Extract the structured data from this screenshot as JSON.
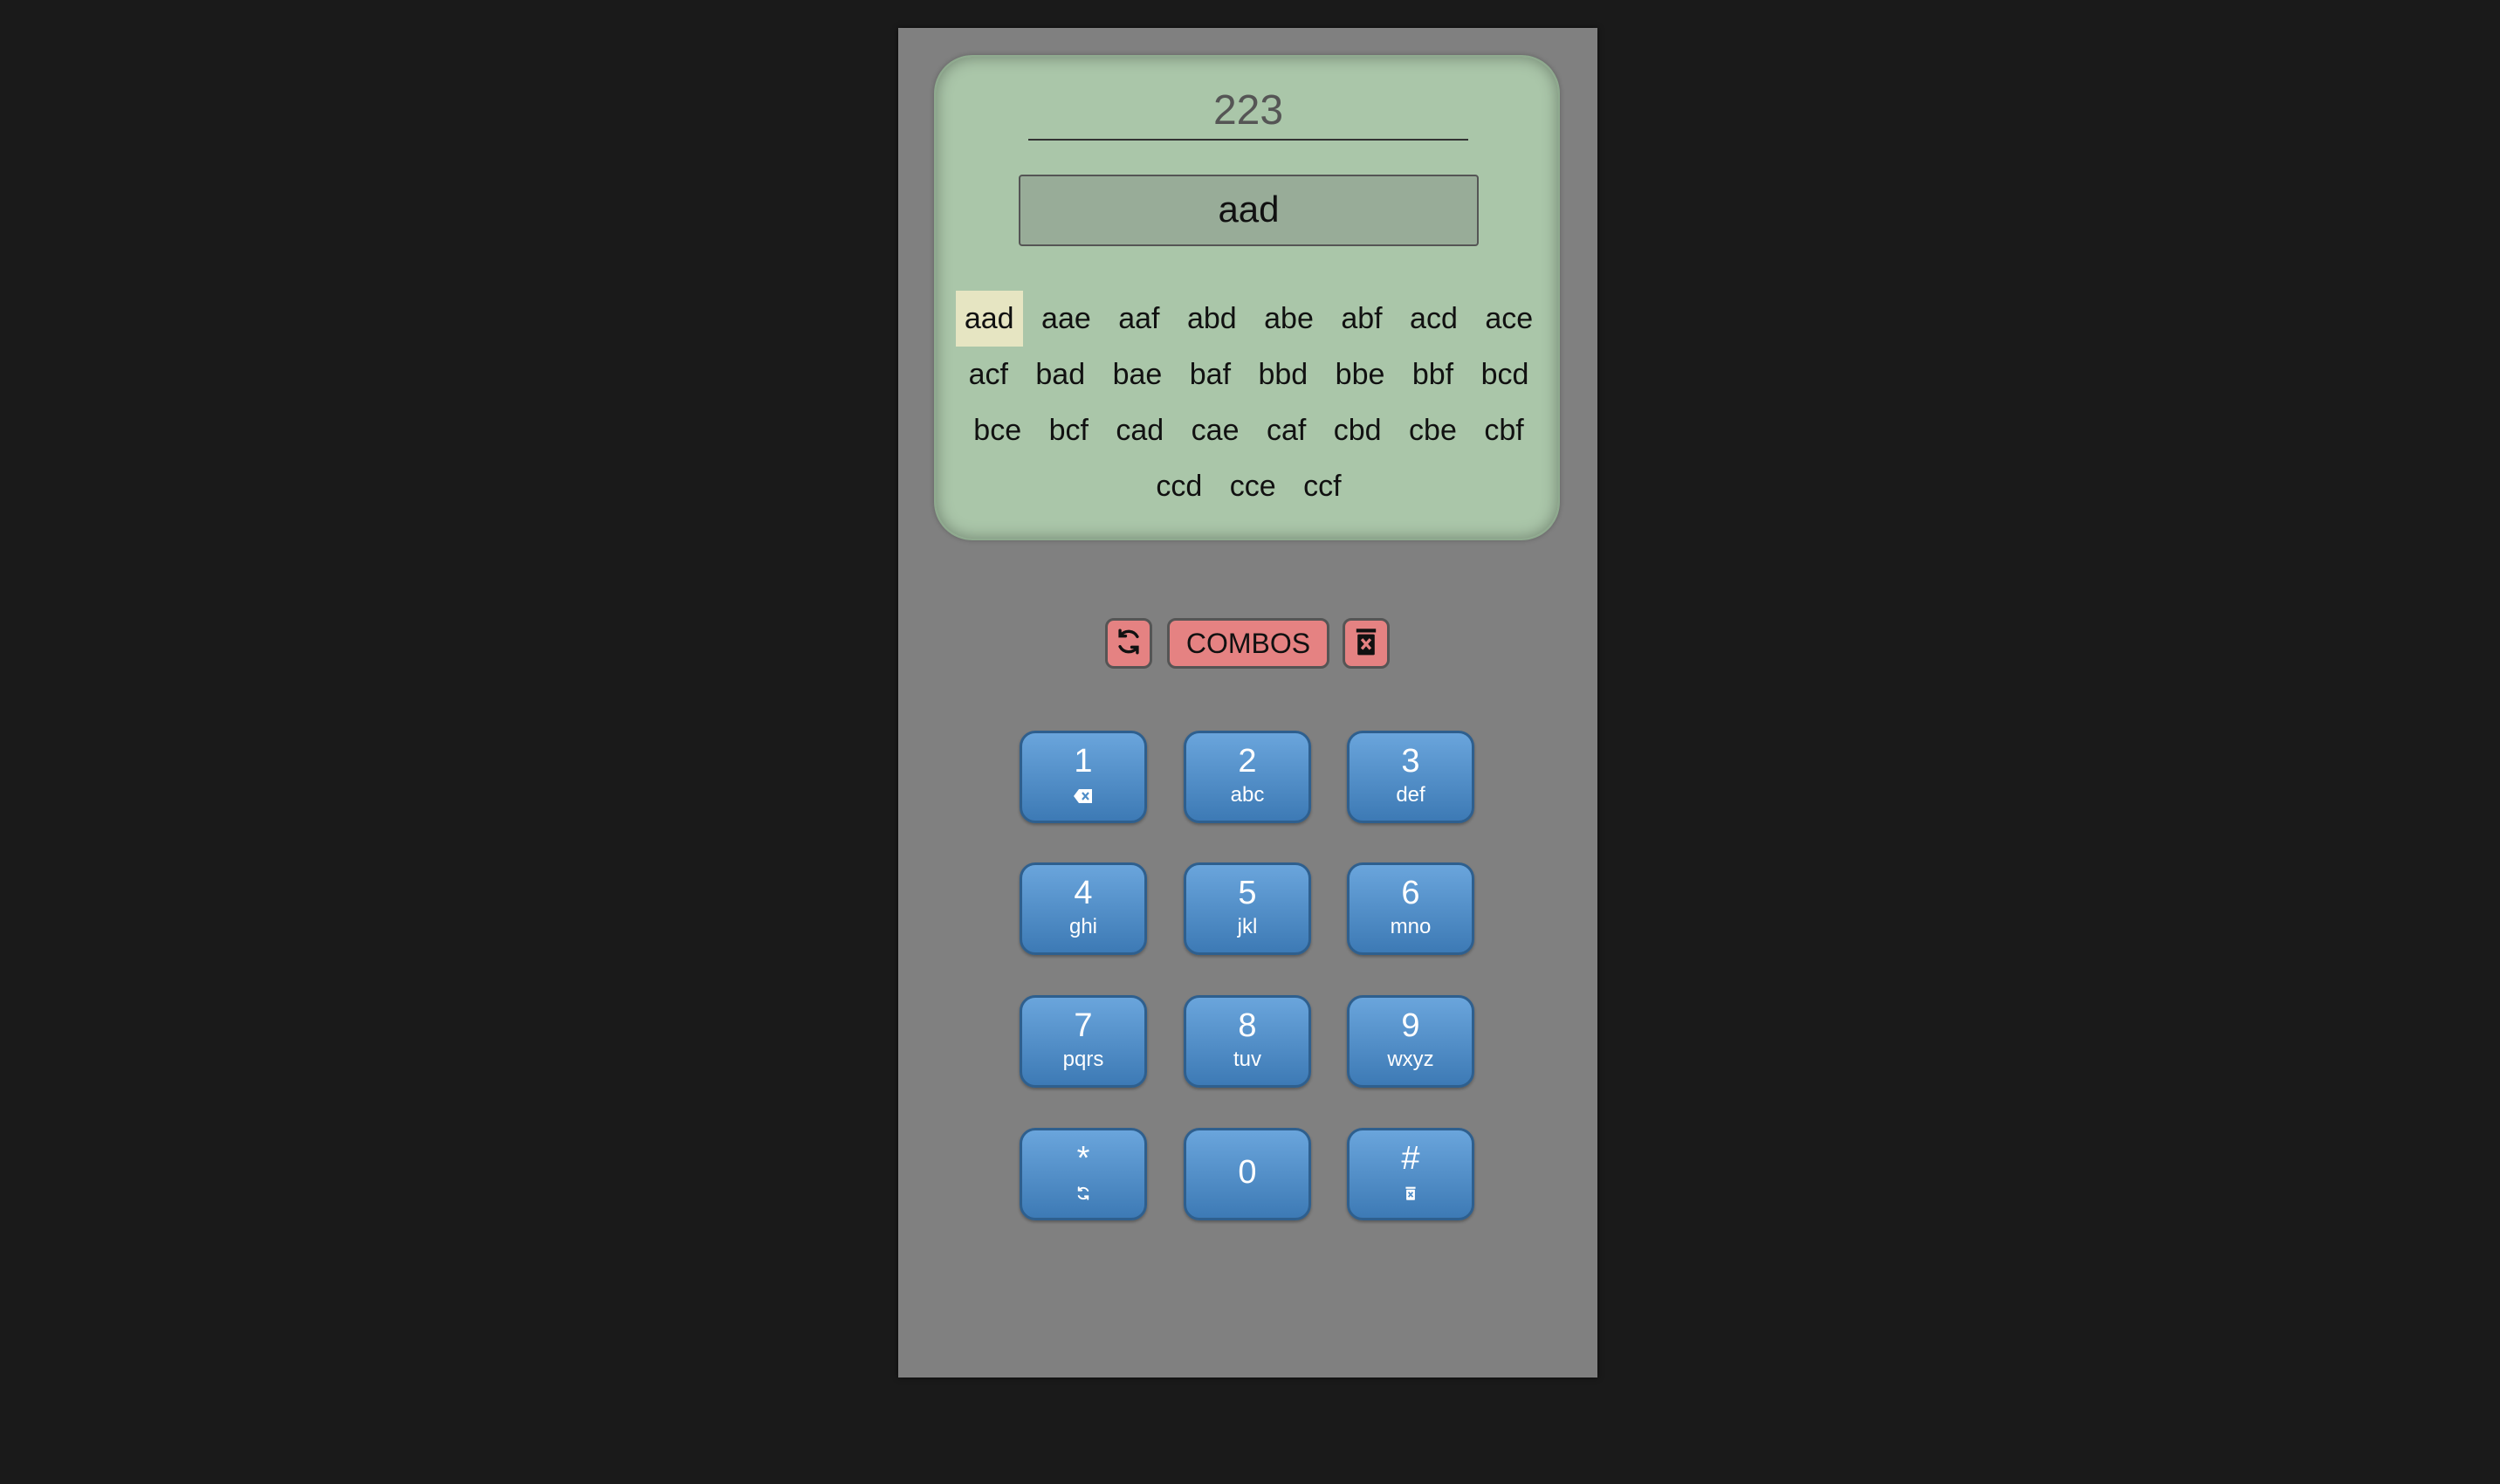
{
  "screen": {
    "digits": "223",
    "current_word": "aad",
    "suggestions": [
      "aad",
      "aae",
      "aaf",
      "abd",
      "abe",
      "abf",
      "acd",
      "ace",
      "acf",
      "bad",
      "bae",
      "baf",
      "bbd",
      "bbe",
      "bbf",
      "bcd",
      "bce",
      "bcf",
      "cad",
      "cae",
      "caf",
      "cbd",
      "cbe",
      "cbf",
      "ccd",
      "cce",
      "ccf"
    ],
    "selected_index": 0
  },
  "controls": {
    "cycle_icon": "refresh-icon",
    "combos_label": "COMBOS",
    "clear_icon": "trash-icon"
  },
  "keypad": {
    "keys": [
      {
        "num": "1",
        "sub": "",
        "icon": "backspace-icon"
      },
      {
        "num": "2",
        "sub": "abc"
      },
      {
        "num": "3",
        "sub": "def"
      },
      {
        "num": "4",
        "sub": "ghi"
      },
      {
        "num": "5",
        "sub": "jkl"
      },
      {
        "num": "6",
        "sub": "mno"
      },
      {
        "num": "7",
        "sub": "pqrs"
      },
      {
        "num": "8",
        "sub": "tuv"
      },
      {
        "num": "9",
        "sub": "wxyz"
      },
      {
        "num": "*",
        "sub": "",
        "icon": "refresh-icon"
      },
      {
        "num": "0",
        "sub": ""
      },
      {
        "num": "#",
        "sub": "",
        "icon": "trash-icon"
      }
    ]
  },
  "colors": {
    "background": "#1a1a1a",
    "phone": "#808080",
    "screen": "#aac6a9",
    "control_button": "#e58282",
    "key": "#4f8dc8",
    "selected_suggestion": "#e6e5c2"
  }
}
